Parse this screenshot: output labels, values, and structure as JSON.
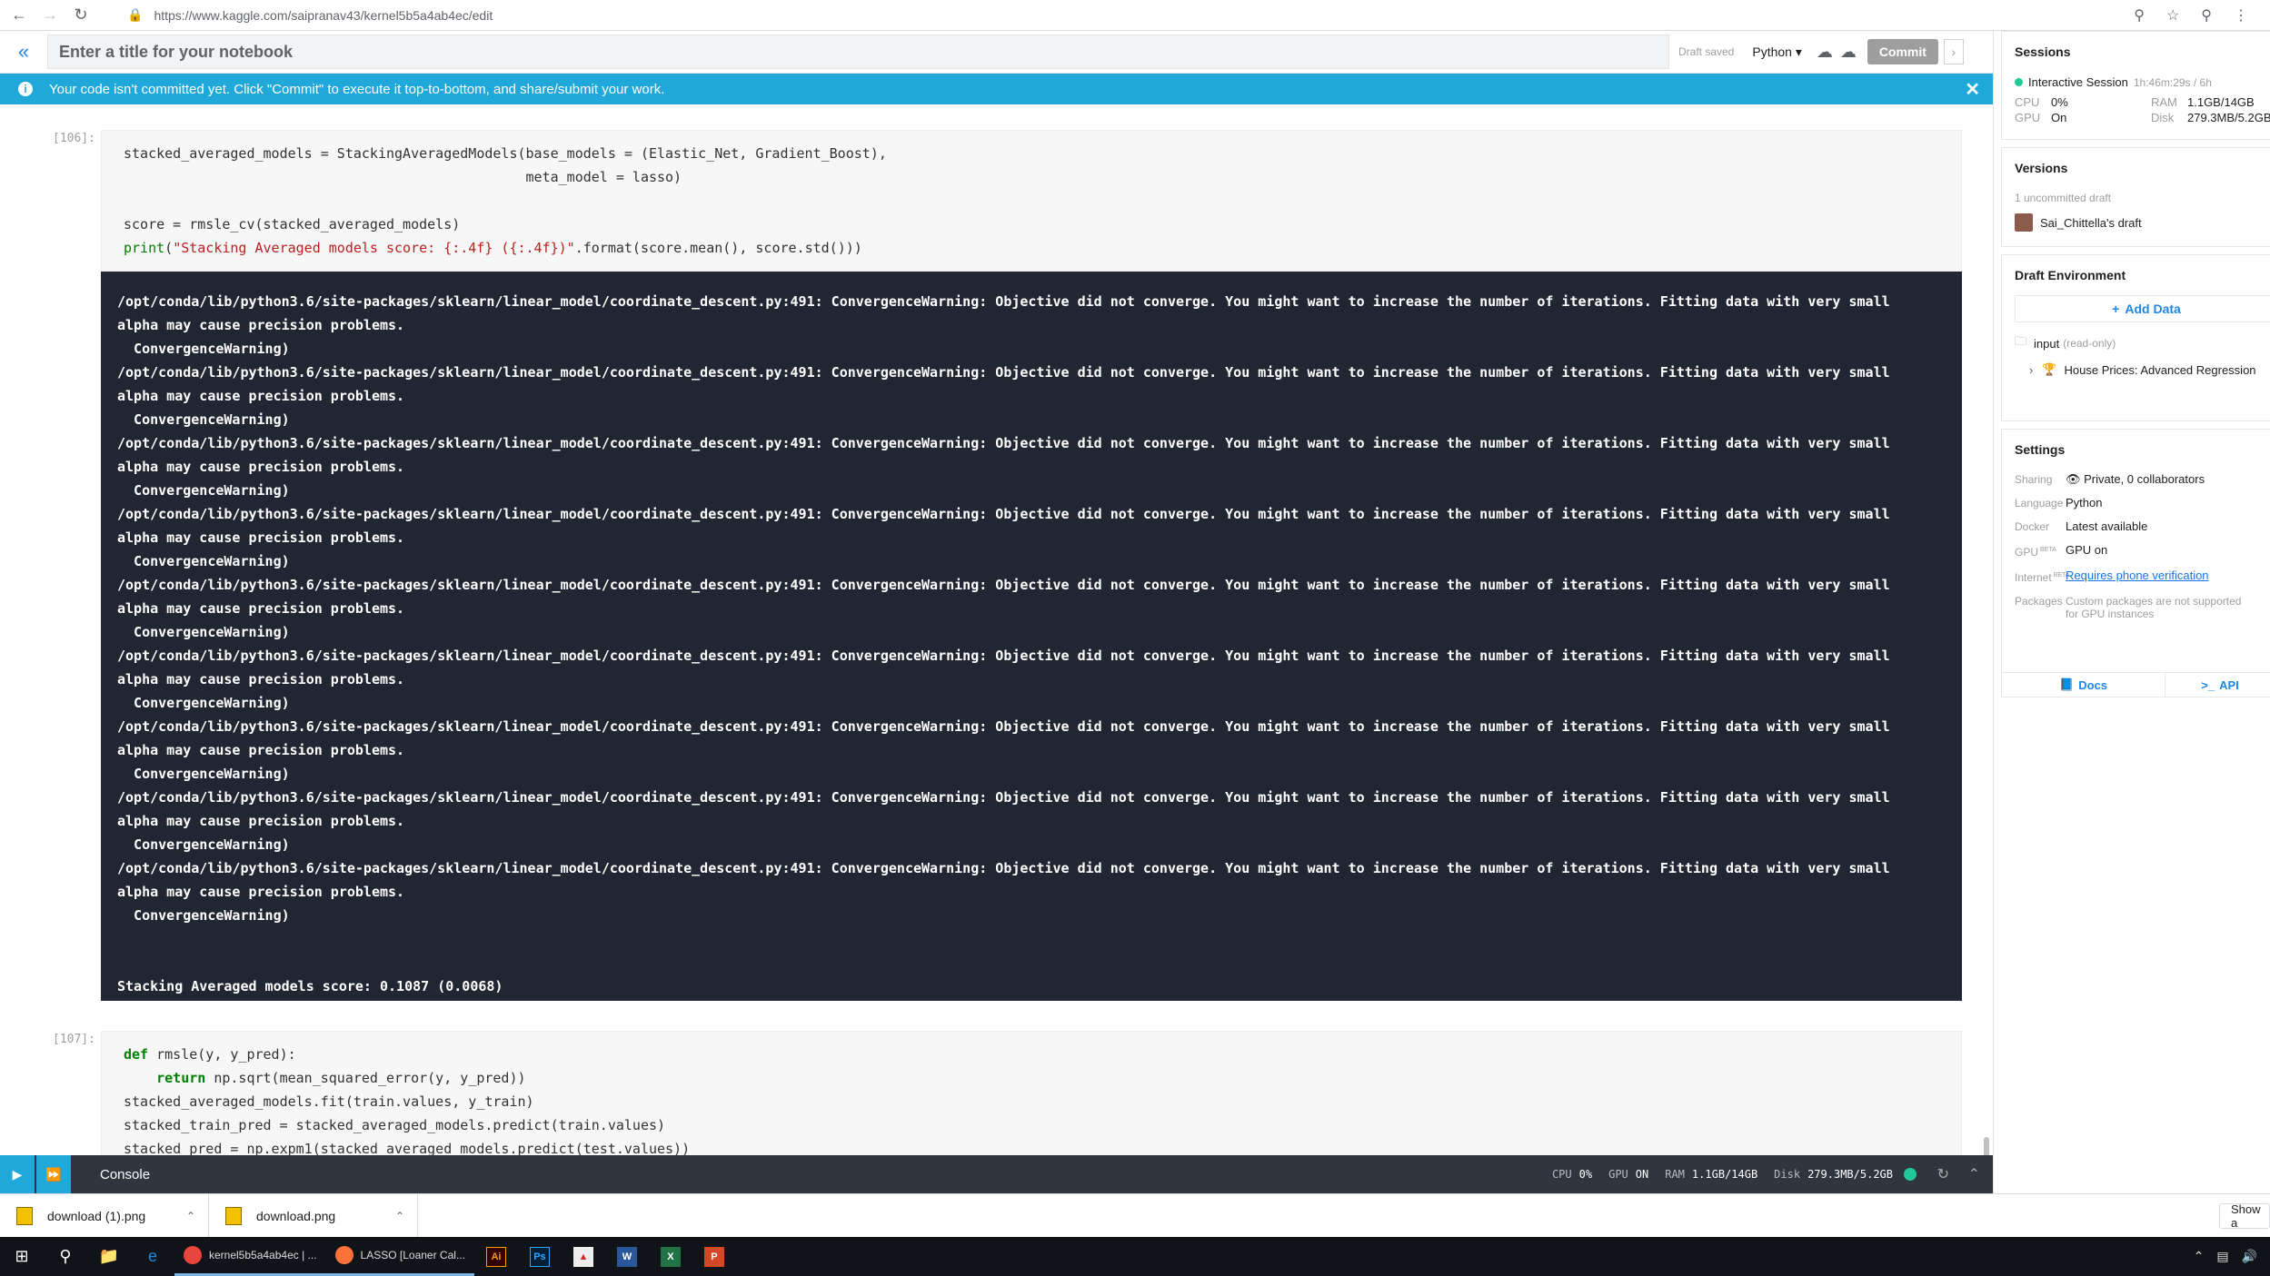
{
  "browser": {
    "url": "https://www.kaggle.com/saipranav43/kernel5b5a4ab4ec/edit"
  },
  "editor": {
    "title_placeholder": "Enter a title for your notebook",
    "draft_status": "Draft saved",
    "language": "Python",
    "commit_label": "Commit"
  },
  "banner": {
    "message": "Your code isn't committed yet. Click \"Commit\" to execute it top-to-bottom, and share/submit your work."
  },
  "cells": [
    {
      "prompt": "[106]:",
      "code_lines": [
        "stacked_averaged_models = StackingAveragedModels(base_models = (Elastic_Net, Gradient_Boost),",
        "                                                 meta_model = lasso)",
        "",
        "score = rmsle_cv(stacked_averaged_models)",
        "print(\"Stacking Averaged models score: {:.4f} ({:.4f})\".format(score.mean(), score.std()))"
      ],
      "output_lines": [
        "/opt/conda/lib/python3.6/site-packages/sklearn/linear_model/coordinate_descent.py:491: ConvergenceWarning: Objective did not converge. You might want to increase the number of iterations. Fitting data with very small",
        "alpha may cause precision problems.",
        "  ConvergenceWarning)",
        "/opt/conda/lib/python3.6/site-packages/sklearn/linear_model/coordinate_descent.py:491: ConvergenceWarning: Objective did not converge. You might want to increase the number of iterations. Fitting data with very small",
        "alpha may cause precision problems.",
        "  ConvergenceWarning)",
        "/opt/conda/lib/python3.6/site-packages/sklearn/linear_model/coordinate_descent.py:491: ConvergenceWarning: Objective did not converge. You might want to increase the number of iterations. Fitting data with very small",
        "alpha may cause precision problems.",
        "  ConvergenceWarning)",
        "/opt/conda/lib/python3.6/site-packages/sklearn/linear_model/coordinate_descent.py:491: ConvergenceWarning: Objective did not converge. You might want to increase the number of iterations. Fitting data with very small",
        "alpha may cause precision problems.",
        "  ConvergenceWarning)",
        "/opt/conda/lib/python3.6/site-packages/sklearn/linear_model/coordinate_descent.py:491: ConvergenceWarning: Objective did not converge. You might want to increase the number of iterations. Fitting data with very small",
        "alpha may cause precision problems.",
        "  ConvergenceWarning)",
        "/opt/conda/lib/python3.6/site-packages/sklearn/linear_model/coordinate_descent.py:491: ConvergenceWarning: Objective did not converge. You might want to increase the number of iterations. Fitting data with very small",
        "alpha may cause precision problems.",
        "  ConvergenceWarning)",
        "/opt/conda/lib/python3.6/site-packages/sklearn/linear_model/coordinate_descent.py:491: ConvergenceWarning: Objective did not converge. You might want to increase the number of iterations. Fitting data with very small",
        "alpha may cause precision problems.",
        "  ConvergenceWarning)",
        "/opt/conda/lib/python3.6/site-packages/sklearn/linear_model/coordinate_descent.py:491: ConvergenceWarning: Objective did not converge. You might want to increase the number of iterations. Fitting data with very small",
        "alpha may cause precision problems.",
        "  ConvergenceWarning)",
        "/opt/conda/lib/python3.6/site-packages/sklearn/linear_model/coordinate_descent.py:491: ConvergenceWarning: Objective did not converge. You might want to increase the number of iterations. Fitting data with very small",
        "alpha may cause precision problems.",
        "  ConvergenceWarning)",
        "",
        "",
        "Stacking Averaged models score: 0.1087 (0.0068)"
      ]
    },
    {
      "prompt": "[107]:",
      "code_lines": [
        "def rmsle(y, y_pred):",
        "    return np.sqrt(mean_squared_error(y, y_pred))",
        "stacked_averaged_models.fit(train.values, y_train)",
        "stacked_train_pred = stacked_averaged_models.predict(train.values)",
        "stacked_pred = np.expm1(stacked_averaged_models.predict(test.values))"
      ]
    }
  ],
  "console": {
    "label": "Console",
    "cpu_label": "CPU",
    "cpu_value": "0%",
    "gpu_label": "GPU",
    "gpu_value": "ON",
    "ram_label": "RAM",
    "ram_value": "1.1GB/14GB",
    "disk_label": "Disk",
    "disk_value": "279.3MB/5.2GB"
  },
  "panel": {
    "sessions": {
      "title": "Sessions",
      "session_name": "Interactive Session",
      "session_time": "1h:46m:29s / 6h",
      "cpu_label": "CPU",
      "cpu_value": "0%",
      "ram_label": "RAM",
      "ram_value": "1.1GB/14GB",
      "gpu_label": "GPU",
      "gpu_value": "On",
      "disk_label": "Disk",
      "disk_value": "279.3MB/5.2GB"
    },
    "versions": {
      "title": "Versions",
      "uncommitted": "1 uncommitted draft",
      "draft_name": "Sai_Chittella's draft"
    },
    "draft_env": {
      "title": "Draft Environment",
      "add_data": "Add Data",
      "input_label": "input",
      "input_note": "(read-only)",
      "dataset": "House Prices: Advanced Regression"
    },
    "settings": {
      "title": "Settings",
      "rows": [
        {
          "label": "Sharing",
          "value": "Private, 0 collaborators"
        },
        {
          "label": "Language",
          "value": "Python"
        },
        {
          "label": "Docker",
          "value": "Latest available"
        },
        {
          "label": "GPU",
          "value": "GPU on"
        },
        {
          "label": "Internet",
          "value": "Requires phone verification"
        },
        {
          "label": "Packages",
          "value": "Custom packages are not supported for GPU instances"
        }
      ],
      "beta": "BETA"
    },
    "footer": {
      "docs": "Docs",
      "api": "API"
    }
  },
  "downloads": [
    {
      "name": "download (1).png"
    },
    {
      "name": "download.png"
    }
  ],
  "downloads_show": "Show a",
  "taskbar": {
    "apps": [
      {
        "label": "kernel5b5a4ab4ec | ..."
      },
      {
        "label": "LASSO [Loaner Cal..."
      }
    ]
  }
}
